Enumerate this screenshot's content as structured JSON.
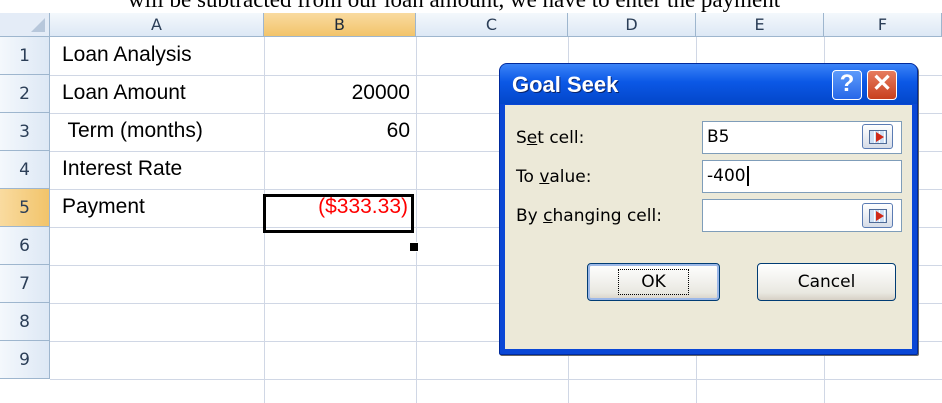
{
  "background_text": "will be subtracted from our loan amount, we have to enter the payment",
  "columns": [
    "A",
    "B",
    "C",
    "D",
    "E",
    "F"
  ],
  "active_column": "B",
  "rows": [
    "1",
    "2",
    "3",
    "4",
    "5",
    "6",
    "7",
    "8",
    "9"
  ],
  "active_row": "5",
  "cells": {
    "a1": "Loan Analysis",
    "a2": "Loan Amount",
    "b2": "20000",
    "a3": " Term (months)",
    "b3": "60",
    "a4": "Interest Rate",
    "a5": "Payment",
    "b5": "($333.33)"
  },
  "colors": {
    "negative_value": "#ff0000",
    "title_bar": "#0a58e6"
  },
  "dialog": {
    "title": "Goal Seek",
    "help_glyph": "?",
    "close_glyph": "✕",
    "set_cell_label_pre": "S",
    "set_cell_label_u": "e",
    "set_cell_label_post": "t cell:",
    "set_cell_value": "B5",
    "to_value_label_pre": "To ",
    "to_value_label_u": "v",
    "to_value_label_post": "alue:",
    "to_value_value": "-400",
    "changing_label_pre": "By ",
    "changing_label_u": "c",
    "changing_label_post": "hanging cell:",
    "changing_value": "",
    "ok_label": "OK",
    "cancel_label": "Cancel",
    "ref_icon": "collapse-dialog-icon"
  }
}
